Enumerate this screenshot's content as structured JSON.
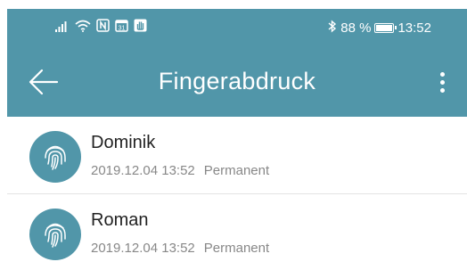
{
  "status_bar": {
    "left_icons": [
      "signal-icon",
      "wifi-icon",
      "nfc-icon",
      "calendar-icon",
      "hand-icon"
    ],
    "calendar_day": "31",
    "bluetooth_icon": "bluetooth-icon",
    "battery_label": "88 %",
    "battery_level": 0.88,
    "time": "13:52"
  },
  "toolbar": {
    "back_icon": "arrow-left-icon",
    "title": "Fingerabdruck",
    "menu_icon": "more-vertical-icon"
  },
  "fingerprints": [
    {
      "name": "Dominik",
      "date": "2019.12.04 13:52",
      "type": "Permanent",
      "icon": "fingerprint-icon"
    },
    {
      "name": "Roman",
      "date": "2019.12.04 13:52",
      "type": "Permanent",
      "icon": "fingerprint-icon"
    }
  ],
  "colors": {
    "primary": "#5196a9",
    "text_primary": "#222222",
    "text_secondary": "#888888",
    "divider": "#e3e3e3"
  }
}
